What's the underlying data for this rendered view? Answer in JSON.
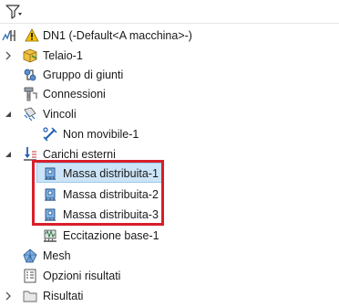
{
  "toolbar": {
    "filter_icon": "funnel-icon"
  },
  "tree": {
    "root": {
      "label": "DN1 (-Default<A macchina>-)",
      "icon": "study-warning-icon"
    },
    "items": [
      {
        "label": "Telaio-1",
        "icon": "frame-part-icon",
        "expandable": true
      },
      {
        "label": "Gruppo di giunti",
        "icon": "joint-group-icon",
        "expandable": false
      },
      {
        "label": "Connessioni",
        "icon": "connections-icon",
        "expandable": false
      },
      {
        "label": "Vincoli",
        "icon": "fixtures-icon",
        "expandable": true,
        "expanded": true
      },
      {
        "label": "Non movibile-1",
        "icon": "fixed-geometry-icon",
        "child": true
      },
      {
        "label": "Carichi esterni",
        "icon": "external-loads-icon",
        "expandable": true,
        "expanded": true
      },
      {
        "label": "Massa distribuita-1",
        "icon": "distributed-mass-icon",
        "child": true,
        "selected": true
      },
      {
        "label": "Massa distribuita-2",
        "icon": "distributed-mass-icon",
        "child": true
      },
      {
        "label": "Massa distribuita-3",
        "icon": "distributed-mass-icon",
        "child": true
      },
      {
        "label": "Eccitazione base-1",
        "icon": "base-excitation-icon",
        "child": true
      },
      {
        "label": "Mesh",
        "icon": "mesh-icon",
        "expandable": false
      },
      {
        "label": "Opzioni risultati",
        "icon": "result-options-icon",
        "expandable": false
      },
      {
        "label": "Risultati",
        "icon": "results-folder-icon",
        "expandable": true
      }
    ]
  },
  "colors": {
    "selection_bg": "#cce4f7",
    "highlight_border": "#d81e2a",
    "text": "#1a1a1a"
  }
}
